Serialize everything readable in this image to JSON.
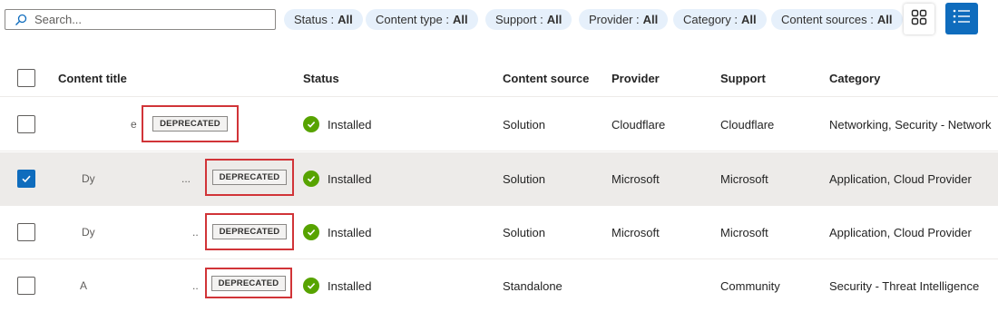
{
  "search": {
    "placeholder": "Search..."
  },
  "filters": [
    {
      "label": "Status :",
      "value": "All"
    },
    {
      "label": "Content type :",
      "value": "All"
    },
    {
      "label": "Support :",
      "value": "All"
    },
    {
      "label": "Provider :",
      "value": "All"
    },
    {
      "label": "Category :",
      "value": "All"
    },
    {
      "label": "Content sources :",
      "value": "All"
    }
  ],
  "colors": {
    "accent": "#0f6cbd",
    "installed": "#57a300",
    "highlight_box": "#d13438",
    "pill_bg": "#e6f0fb"
  },
  "icons": {
    "search": "search-icon",
    "grid_view": "grid-view-icon",
    "list_view": "list-view-icon",
    "status": "checkmark-circle-icon",
    "checkbox": "checkmark-icon"
  },
  "table": {
    "columns": [
      "Content title",
      "Status",
      "Content source",
      "Provider",
      "Support",
      "Category"
    ],
    "rows": [
      {
        "selected": false,
        "title_fragments": [
          "e"
        ],
        "badge": "DEPRECATED",
        "status": "Installed",
        "source": "Solution",
        "provider": "Cloudflare",
        "support": "Cloudflare",
        "category": "Networking, Security - Network"
      },
      {
        "selected": true,
        "title_fragments": [
          "Dy",
          "..."
        ],
        "badge": "DEPRECATED",
        "status": "Installed",
        "source": "Solution",
        "provider": "Microsoft",
        "support": "Microsoft",
        "category": "Application, Cloud Provider"
      },
      {
        "selected": false,
        "title_fragments": [
          "Dy",
          ".."
        ],
        "badge": "DEPRECATED",
        "status": "Installed",
        "source": "Solution",
        "provider": "Microsoft",
        "support": "Microsoft",
        "category": "Application, Cloud Provider"
      },
      {
        "selected": false,
        "title_fragments": [
          "A",
          ".."
        ],
        "badge": "DEPRECATED",
        "status": "Installed",
        "source": "Standalone",
        "provider": "",
        "support": "Community",
        "category": "Security - Threat Intelligence"
      }
    ]
  }
}
